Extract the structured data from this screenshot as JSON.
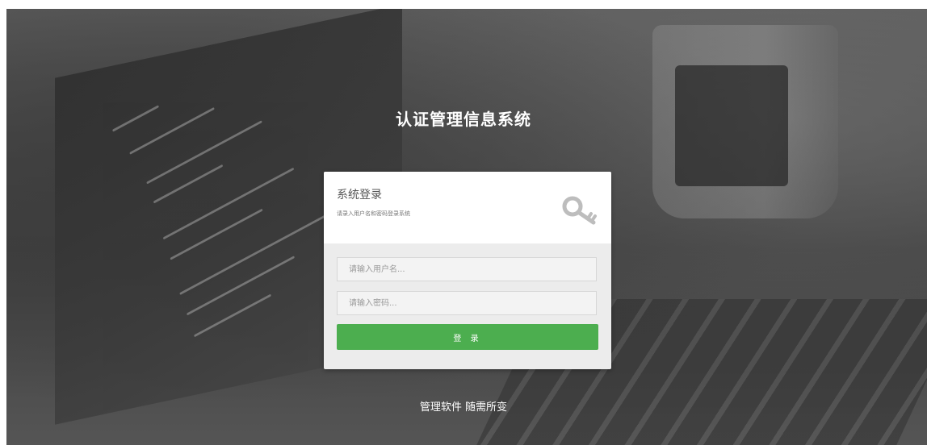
{
  "page": {
    "title": "认证管理信息系统",
    "slogan": "管理软件 随需所变"
  },
  "login": {
    "heading": "系统登录",
    "subheading": "请录入用户名和密码登录系统",
    "header_icon": "key-icon",
    "username_placeholder": "请输入用户名...",
    "username_value": "",
    "password_placeholder": "请输入密码...",
    "password_value": "",
    "submit_label": "登 录"
  },
  "colors": {
    "accent_green": "#4cae4f",
    "card_background": "#ececec",
    "card_header_background": "#ffffff",
    "page_text": "#ffffff"
  }
}
